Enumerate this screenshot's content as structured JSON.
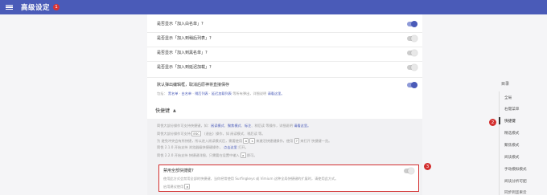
{
  "header": {
    "title": "高级设定",
    "badge": "1"
  },
  "settings": [
    {
      "label": "是否显示「加入白名单」?",
      "on": true
    },
    {
      "label": "是否显示「加入到稍后列表」?",
      "on": false
    },
    {
      "label": "是否显示「加入到黑名单」?",
      "on": false
    },
    {
      "label": "是否显示「加入到延迟加载」?",
      "on": false
    },
    {
      "label": "默认弹出编辑框，取消后原神将直接保存",
      "on": true
    }
  ],
  "settings_sub": {
    "prefix": "包括：",
    "links": [
      "黑名单",
      "白名单",
      "稍后列表",
      "延迟加载列表"
    ],
    "middle": "等所有弹出，详细说明",
    "link_last": "请看这里。"
  },
  "shortcut_section": {
    "title": "快捷键",
    "lines": {
      "l1_text": "简悦大部分操作可支持快捷键，如：",
      "l1_links": [
        "阅读模式",
        "聚焦模式",
        "标注"
      ],
      "l1_rest": "、稍后读 等操作，详细说明",
      "l1_link": "请看这里。",
      "l2_text": "简悦大部分操作可支持",
      "l2_key": "ESC",
      "l2_rest": "（退出）操作，如 阅读模式、稍后读 等。",
      "l3_text": "为 避免冲突会有所快捷，所以进入阅读模式后，需要使用",
      "l3_key1": "a",
      "l3_key2": "s",
      "l3_rest": "来激活快捷键操作，使用",
      "l3_key3": "?",
      "l3_end": "来打开 快捷键一览。",
      "l4_text": "简悦 2.1.0 开始支持 浏览器级快捷键操作，",
      "l4_link": "点击这里",
      "l4_rest": "打开。",
      "l5_text": "简悦 2.2.0 开始支持 快捷键详细，只需要在设置中输入",
      "l5_key": "a",
      "l5_rest": "即可。"
    }
  },
  "highlight": {
    "label": "禁用全部快捷键?",
    "on": false,
    "desc1": "使用此方式会禁用全部的快捷键，当你经常使用 Surfingkeys 或 Vimium 这种全局快捷键的扩展时，请使用此方式。",
    "desc2_text": "启用建议使用",
    "desc2_key": "a"
  },
  "markers": {
    "m2": "2",
    "m3": "3"
  },
  "toc": {
    "title": "目录",
    "items": [
      "全局",
      "右键菜单",
      "快捷键",
      "精选模式",
      "聚焦模式",
      "阅读模式",
      "手动模拟模式",
      "阅读分析可配",
      "同步到坚果云"
    ],
    "active_index": 2
  },
  "colors": {
    "accent": "#4a5bb8",
    "highlight": "#d32f2f"
  }
}
